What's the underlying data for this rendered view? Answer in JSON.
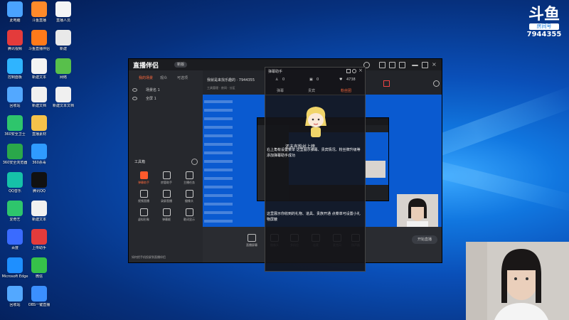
{
  "desktop_icons": [
    {
      "label": "此电脑"
    },
    {
      "label": "斗鱼直播"
    },
    {
      "label": "直播人员"
    },
    {
      "label": "腾讯视频"
    },
    {
      "label": "斗鱼直播伴侣"
    },
    {
      "label": "新建"
    },
    {
      "label": "控制面板"
    },
    {
      "label": "新建文本"
    },
    {
      "label": "网络"
    },
    {
      "label": "回收站"
    },
    {
      "label": "新建文档"
    },
    {
      "label": "新建文本文档"
    },
    {
      "label": "360安全卫士"
    },
    {
      "label": "直播素材"
    },
    {
      "label": "360安全浏览器"
    },
    {
      "label": "360杀毒"
    },
    {
      "label": "QQ音乐"
    },
    {
      "label": "腾讯QQ"
    },
    {
      "label": "爱奇艺"
    },
    {
      "label": "新建文本"
    },
    {
      "label": "百度"
    },
    {
      "label": "上传助手"
    },
    {
      "label": "Microsoft Edge"
    },
    {
      "label": "微信"
    },
    {
      "label": "回收站"
    },
    {
      "label": "OBS一键直播"
    }
  ],
  "douyu": {
    "logo": "斗鱼",
    "tag": "房间号",
    "room_number": "7944355"
  },
  "app": {
    "brand": "直播伴侣",
    "version_badge": "新版",
    "left_tabs": [
      "我的场景",
      "观众",
      "可选项"
    ],
    "scenes": [
      "场景名 1",
      "全屏 1"
    ],
    "toolbox_title": "工具箱",
    "tools": [
      {
        "label": "弹幕助手",
        "hot": true
      },
      {
        "label": "房管助手",
        "hot": false
      },
      {
        "label": "主播任务",
        "hot": false
      },
      {
        "label": "视频直播",
        "hot": false
      },
      {
        "label": "录屏直播",
        "hot": false
      },
      {
        "label": "摄像头",
        "hot": false
      },
      {
        "label": "虚拟形象",
        "hot": false
      },
      {
        "label": "弹幕姬",
        "hot": false
      },
      {
        "label": "歌词显示",
        "hot": false
      }
    ],
    "left_footer": "如何把手机投屏到直播伴侣",
    "room_title": "我就是来找乐趣的 · 7944355",
    "room_meta": "工具管理 · 房间 · 分区",
    "bottom_buttons": [
      "直播屏幕",
      "摄像头",
      "多机位",
      "连麦",
      "麦克风",
      "扬声器"
    ],
    "start_button": "开始直播"
  },
  "overlay": {
    "title": "弹幕助手",
    "stats": [
      "0",
      "0",
      "4738"
    ],
    "tabs": [
      "弹幕",
      "贵宾",
      "粉丝团"
    ],
    "active_tab": 2,
    "empty_caption": "还未有粉丝上榜",
    "text_block_1": "右上角有设置菜单 这里展示弹幕、贵宾情况、粉丝牌升级等 添加弹幕助手成功",
    "text_block_2": "这里展示你收到的礼物、道具、贵族开通 点菜单可设置小礼物屏蔽"
  },
  "colors": {
    "accent": "#ff6a3d",
    "desktop_blue": "#0a4fb8"
  }
}
